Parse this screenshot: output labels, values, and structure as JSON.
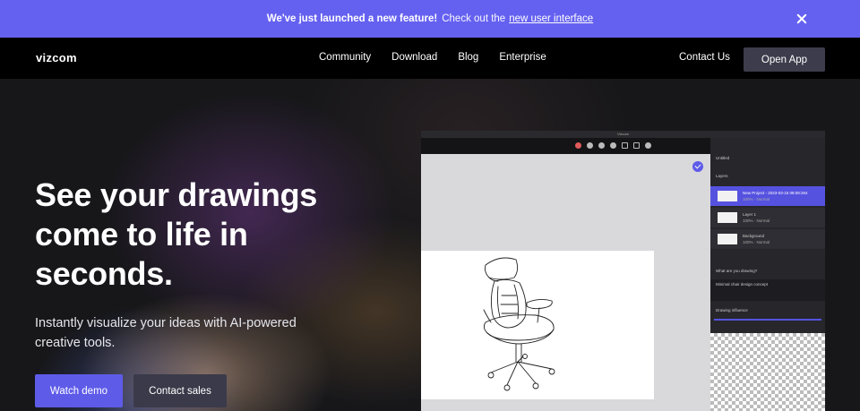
{
  "banner": {
    "strong_text": "We've just launched a new feature!",
    "cta_text": "Check out the",
    "link_text": "new user interface"
  },
  "nav": {
    "logo": "vizcom",
    "links": [
      "Community",
      "Download",
      "Blog",
      "Enterprise"
    ],
    "contact_label": "Contact Us",
    "open_app_label": "Open App"
  },
  "hero": {
    "title": "See your drawings come to life in seconds.",
    "subtitle": "Instantly visualize your ideas with AI-powered creative tools.",
    "watch_demo_label": "Watch demo",
    "contact_sales_label": "Contact sales"
  },
  "app_preview": {
    "window_title": "Vizcom",
    "side_header": "Untitled",
    "layers_label": "Layers",
    "layers": [
      {
        "name": "New Project - 2023-03-15 08:08:264",
        "sub": "100% · Normal"
      },
      {
        "name": "Layer 1",
        "sub": "100% · Normal"
      },
      {
        "name": "Background",
        "sub": "100% · Normal"
      }
    ],
    "prompt_label": "What are you drawing?",
    "prompt_value": "Minimal chair design concept",
    "influence_label": "Drawing influence"
  },
  "colors": {
    "accent": "#6561f0",
    "button_primary": "#5e5be9",
    "button_secondary": "#3a3a4a",
    "nav_bg": "#000000"
  }
}
